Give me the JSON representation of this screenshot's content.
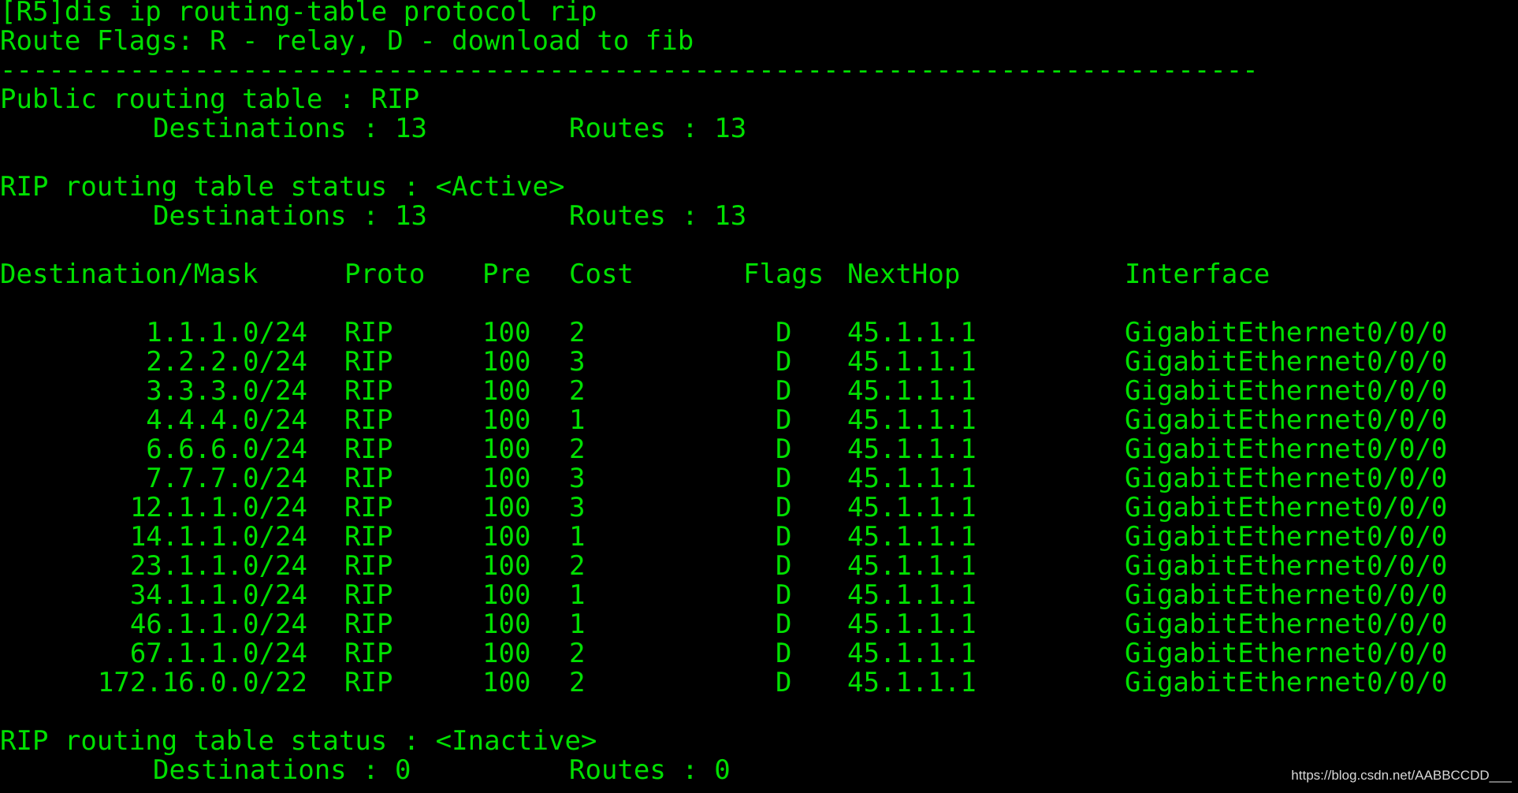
{
  "terminal": {
    "command_line": "[R5]dis ip routing-table protocol rip",
    "flags_line": "Route Flags: R - relay, D - download to fib",
    "separator": "------------------------------------------------------------------------------",
    "public_title": "Public routing table : RIP",
    "public_summary": {
      "destinations_label": "Destinations : 13",
      "routes_label": "Routes : 13"
    },
    "active_title": "RIP routing table status : <Active>",
    "active_summary": {
      "destinations_label": "Destinations : 13",
      "routes_label": "Routes : 13"
    },
    "table_headers": {
      "destination": "Destination/Mask",
      "proto": "Proto",
      "pre": "Pre",
      "cost": "Cost",
      "flags": "Flags",
      "nexthop": "NextHop",
      "interface": "Interface"
    },
    "routes": [
      {
        "destination": "1.1.1.0/24",
        "proto": "RIP",
        "pre": "100",
        "cost": "2",
        "flags": "D",
        "nexthop": "45.1.1.1",
        "interface": "GigabitEthernet0/0/0"
      },
      {
        "destination": "2.2.2.0/24",
        "proto": "RIP",
        "pre": "100",
        "cost": "3",
        "flags": "D",
        "nexthop": "45.1.1.1",
        "interface": "GigabitEthernet0/0/0"
      },
      {
        "destination": "3.3.3.0/24",
        "proto": "RIP",
        "pre": "100",
        "cost": "2",
        "flags": "D",
        "nexthop": "45.1.1.1",
        "interface": "GigabitEthernet0/0/0"
      },
      {
        "destination": "4.4.4.0/24",
        "proto": "RIP",
        "pre": "100",
        "cost": "1",
        "flags": "D",
        "nexthop": "45.1.1.1",
        "interface": "GigabitEthernet0/0/0"
      },
      {
        "destination": "6.6.6.0/24",
        "proto": "RIP",
        "pre": "100",
        "cost": "2",
        "flags": "D",
        "nexthop": "45.1.1.1",
        "interface": "GigabitEthernet0/0/0"
      },
      {
        "destination": "7.7.7.0/24",
        "proto": "RIP",
        "pre": "100",
        "cost": "3",
        "flags": "D",
        "nexthop": "45.1.1.1",
        "interface": "GigabitEthernet0/0/0"
      },
      {
        "destination": "12.1.1.0/24",
        "proto": "RIP",
        "pre": "100",
        "cost": "3",
        "flags": "D",
        "nexthop": "45.1.1.1",
        "interface": "GigabitEthernet0/0/0"
      },
      {
        "destination": "14.1.1.0/24",
        "proto": "RIP",
        "pre": "100",
        "cost": "1",
        "flags": "D",
        "nexthop": "45.1.1.1",
        "interface": "GigabitEthernet0/0/0"
      },
      {
        "destination": "23.1.1.0/24",
        "proto": "RIP",
        "pre": "100",
        "cost": "2",
        "flags": "D",
        "nexthop": "45.1.1.1",
        "interface": "GigabitEthernet0/0/0"
      },
      {
        "destination": "34.1.1.0/24",
        "proto": "RIP",
        "pre": "100",
        "cost": "1",
        "flags": "D",
        "nexthop": "45.1.1.1",
        "interface": "GigabitEthernet0/0/0"
      },
      {
        "destination": "46.1.1.0/24",
        "proto": "RIP",
        "pre": "100",
        "cost": "1",
        "flags": "D",
        "nexthop": "45.1.1.1",
        "interface": "GigabitEthernet0/0/0"
      },
      {
        "destination": "67.1.1.0/24",
        "proto": "RIP",
        "pre": "100",
        "cost": "2",
        "flags": "D",
        "nexthop": "45.1.1.1",
        "interface": "GigabitEthernet0/0/0"
      },
      {
        "destination": "172.16.0.0/22",
        "proto": "RIP",
        "pre": "100",
        "cost": "2",
        "flags": "D",
        "nexthop": "45.1.1.1",
        "interface": "GigabitEthernet0/0/0"
      }
    ],
    "inactive_title": "RIP routing table status : <Inactive>",
    "inactive_summary": {
      "destinations_label": "Destinations : 0",
      "routes_label": "Routes : 0"
    }
  },
  "watermark": "https://blog.csdn.net/AABBCCDD___",
  "colors": {
    "background": "#000000",
    "text": "#00e000",
    "watermark": "#d8d8d8"
  }
}
